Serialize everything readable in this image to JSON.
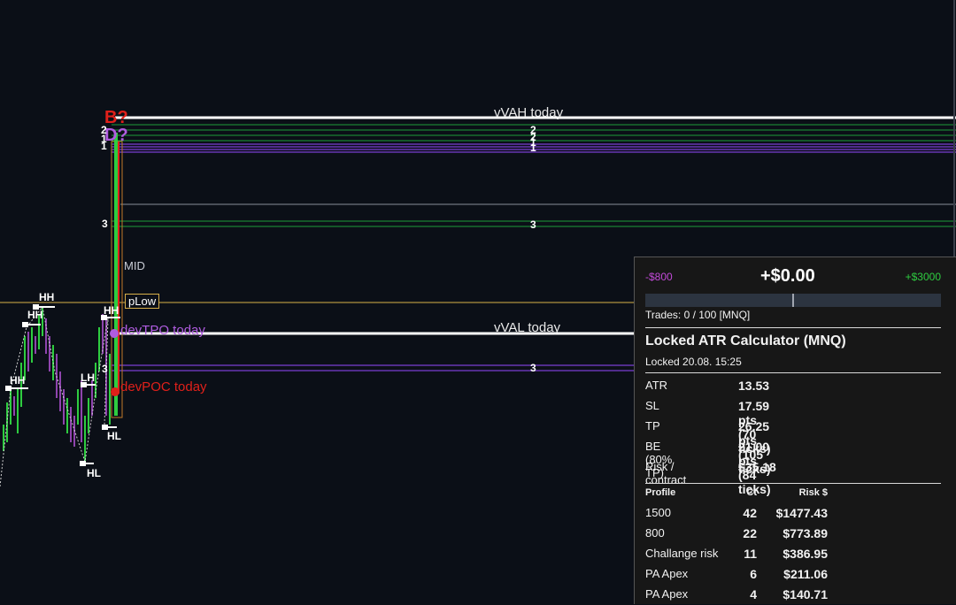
{
  "colors": {
    "background": "#0b0f17",
    "bull": "#2ecc40",
    "bear": "#8e44ad",
    "poc": "#e0201a",
    "tpo": "#b05ce0",
    "level_green": "#1e9e3a",
    "level_purple": "#7a3fd1",
    "plow_line": "#d8b04a"
  },
  "chart": {
    "vah_label": "vVAH today",
    "val_label": "vVAL today",
    "tpo_label": "devTPO today",
    "poc_label": "devPOC today",
    "mid_label": "MID",
    "plow_label": "pLow",
    "b_marker": "B?",
    "d_marker": "D?",
    "swing_hh": "HH",
    "swing_lh": "LH",
    "swing_hl": "HL",
    "lvl_1": "1",
    "lvl_2": "2",
    "lvl_3": "3"
  },
  "panel": {
    "pnl_min": "-$800",
    "pnl_value": "+$0.00",
    "pnl_max": "+$3000",
    "trades": "Trades: 0 / 100 [MNQ]",
    "title": "Locked ATR Calculator (MNQ)",
    "locked": "Locked 20.08. 15:25",
    "stats": [
      {
        "k": "ATR",
        "v": "13.53"
      },
      {
        "k": "SL",
        "v": "17.59 pts  (70 ticks)"
      },
      {
        "k": "TP",
        "v": "26.25 pts  (105 ticks)"
      },
      {
        "k": "BE (80% TP)",
        "v": "21.00 pts  (84 ticks)"
      },
      {
        "k": "Risk / contract",
        "v": "$35.18"
      }
    ],
    "table_head": {
      "profile": "Profile",
      "ct": "Ct",
      "risk": "Risk $"
    },
    "table": [
      {
        "profile": "1500",
        "ct": "42",
        "risk": "$1477.43"
      },
      {
        "profile": "800",
        "ct": "22",
        "risk": "$773.89"
      },
      {
        "profile": "Challange risk",
        "ct": "11",
        "risk": "$386.95"
      },
      {
        "profile": "PA Apex",
        "ct": "6",
        "risk": "$211.06"
      },
      {
        "profile": "PA Apex",
        "ct": "4",
        "risk": "$140.71"
      }
    ]
  }
}
